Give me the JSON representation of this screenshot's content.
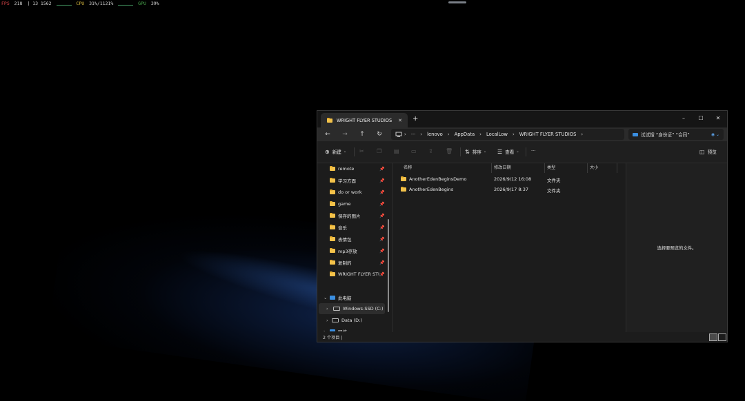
{
  "overlay": {
    "fps_label": "FPS",
    "fps_value": "218",
    "fps_extra": "| 13 1562",
    "cpu_label": "CPU",
    "cpu_value": "31%/1121%",
    "gpu_label": "GPU",
    "gpu_value": "39%"
  },
  "explorer": {
    "tab_title": "WRIGHT FLYER STUDIOS",
    "new_tab": "+",
    "window_controls": {
      "minimize": "–",
      "maximize": "☐",
      "close": "✕"
    },
    "nav": {
      "back": "←",
      "forward": "→",
      "up": "↑",
      "refresh": "↻"
    },
    "breadcrumb": {
      "more": "···",
      "segments": [
        "lenovo",
        "AppData",
        "LocalLow",
        "WRIGHT FLYER STUDIOS"
      ]
    },
    "search": {
      "text": "试试搜 “身份证” “合同”",
      "end_icon": "◉ ⌄"
    },
    "toolbar": {
      "new_label": "新建",
      "sort_label": "排序",
      "view_label": "查看",
      "more_label": "···",
      "preview_label": "预览"
    },
    "sidebar": {
      "pinned": [
        {
          "label": "remote"
        },
        {
          "label": "学习方面"
        },
        {
          "label": "do or work"
        },
        {
          "label": "game"
        },
        {
          "label": "保存的图片"
        },
        {
          "label": "音乐"
        },
        {
          "label": "表情包"
        },
        {
          "label": "mp3存放"
        },
        {
          "label": "复制的"
        },
        {
          "label": "WRIGHT FLYER STUDIOS"
        }
      ],
      "this_pc": "此电脑",
      "drives": [
        {
          "label": "Windows-SSD (C:)",
          "selected": true
        },
        {
          "label": "Data (D:)",
          "selected": false
        }
      ],
      "network": "网络"
    },
    "columns": {
      "name": "名称",
      "modified": "修改日期",
      "type": "类型",
      "size": "大小"
    },
    "rows": [
      {
        "name": "AnotherEdenBeginsDemo",
        "modified": "2026/9/12 16:08",
        "type": "文件夹",
        "size": ""
      },
      {
        "name": "AnotherEdenBegins",
        "modified": "2026/9/17 8:37",
        "type": "文件夹",
        "size": ""
      }
    ],
    "preview_text": "选择要预览的文件。",
    "status": "2 个项目  |"
  },
  "colors": {
    "accent": "#3a8ee0",
    "folder": "#f3c24a",
    "window_bg": "#1c1c1c"
  }
}
